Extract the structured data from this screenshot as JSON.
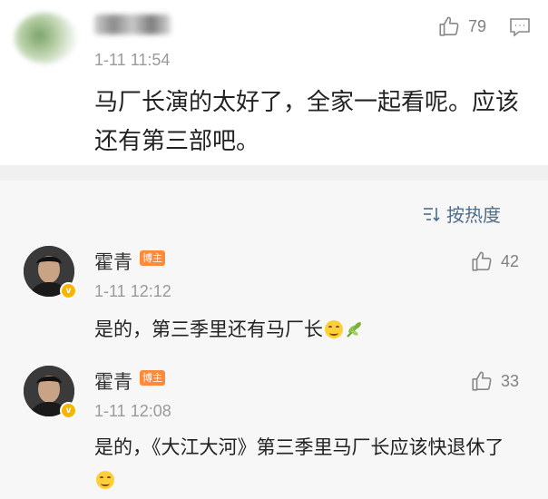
{
  "main_comment": {
    "timestamp": "1-11 11:54",
    "like_count": "79",
    "text": "马厂长演的太好了，全家一起看呢。应该还有第三部吧。"
  },
  "replies_section": {
    "sort_label": "按热度"
  },
  "replies": [
    {
      "name": "霍青",
      "tag": "博主",
      "timestamp": "1-11 12:12",
      "like_count": "42",
      "text": "是的，第三季里还有马厂长"
    },
    {
      "name": "霍青",
      "tag": "博主",
      "timestamp": "1-11 12:08",
      "like_count": "33",
      "text": "是的，《大江大河》第三季里马厂长应该快退休了"
    }
  ],
  "colors": {
    "link_blue": "#4f6d8a",
    "tag_orange": "#ff8a3c",
    "badge_gold": "#f7b500",
    "reply_bg": "#f7f7f7"
  },
  "icons": [
    "thumbs-up-icon",
    "comment-icon",
    "sort-icon",
    "verified-badge-icon",
    "smile-emoji-icon",
    "sprout-emoji-icon"
  ]
}
